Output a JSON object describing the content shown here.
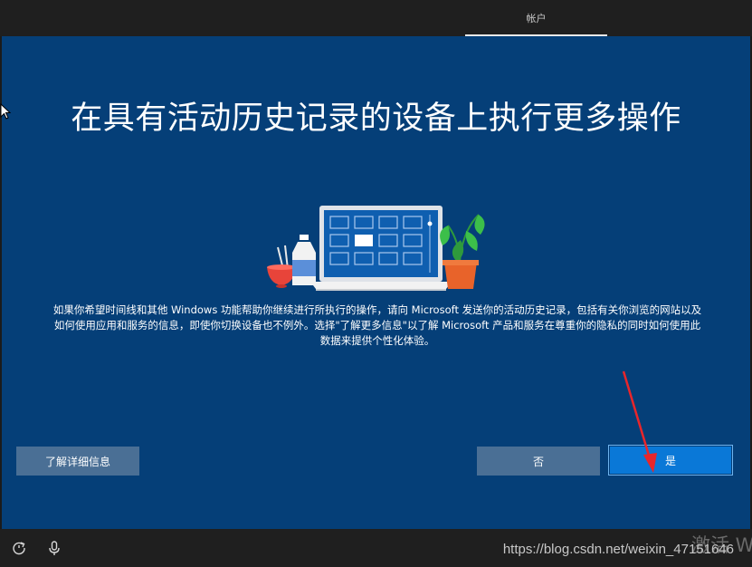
{
  "header": {
    "tab_label": "帐户"
  },
  "main": {
    "title": "在具有活动历史记录的设备上执行更多操作",
    "description_lines": [
      "如果你希望时间线和其他 Windows 功能帮助你继续进行所执行的操作，请向 Microsoft 发送你的活动历史记录，包括有关你浏览的网站以及",
      "如何使用应用和服务的信息，即使你切换设备也不例外。选择\"了解更多信息\"以了解 Microsoft 产品和服务在尊重你的隐私的同时如何使用此",
      "数据来提供个性化体验。"
    ]
  },
  "buttons": {
    "learn_more": "了解详细信息",
    "no": "否",
    "yes": "是"
  },
  "footer": {
    "watermark": "https://blog.csdn.net/weixin_47151646",
    "activate_hint": "激活 W"
  },
  "icons": {
    "ease_of_access": "ease-of-access-icon",
    "microphone": "microphone-icon",
    "cursor": "mouse-cursor-icon"
  },
  "colors": {
    "background": "#053f78",
    "primary_button": "#0a78d7",
    "secondary_button": "#4a6f95",
    "annotation_arrow": "#e8262b"
  }
}
